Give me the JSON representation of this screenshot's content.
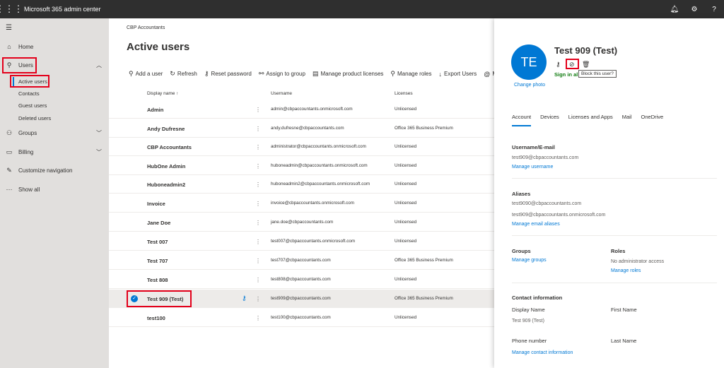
{
  "app": {
    "title": "Microsoft 365 admin center"
  },
  "topbar": {
    "icons": [
      "bell-icon",
      "gear-icon",
      "help-icon"
    ]
  },
  "sidebar": {
    "items": [
      {
        "label": "Home",
        "icon": "home-icon"
      },
      {
        "label": "Users",
        "icon": "person-icon"
      },
      {
        "label": "Groups",
        "icon": "groups-icon"
      },
      {
        "label": "Billing",
        "icon": "billing-icon"
      },
      {
        "label": "Customize navigation",
        "icon": "pencil-icon"
      },
      {
        "label": "Show all",
        "icon": "more-icon"
      }
    ],
    "users_sub": [
      "Active users",
      "Contacts",
      "Guest users",
      "Deleted users"
    ]
  },
  "main": {
    "breadcrumb": "CBP Accountants",
    "title": "Active users",
    "commands": [
      "Add a user",
      "Refresh",
      "Reset password",
      "Assign to group",
      "Manage product licenses",
      "Manage roles",
      "Export Users"
    ],
    "columns": {
      "display_name": "Display name ↑",
      "username": "Username",
      "licenses": "Licenses"
    },
    "rows": [
      {
        "name": "Admin",
        "user": "admin@cbpaccountants.onmicrosoft.com",
        "lic": "Unlicensed"
      },
      {
        "name": "Andy Dufresne",
        "user": "andy.dufresne@cbpaccountants.com",
        "lic": "Office 365 Business Premium"
      },
      {
        "name": "CBP Accountants",
        "user": "administrator@cbpaccountants.onmicrosoft.com",
        "lic": "Unlicensed"
      },
      {
        "name": "HubOne Admin",
        "user": "huboneadmin@cbpaccountants.onmicrosoft.com",
        "lic": "Unlicensed"
      },
      {
        "name": "Huboneadmin2",
        "user": "huboneadmin2@cbpaccountants.onmicrosoft.com",
        "lic": "Unlicensed"
      },
      {
        "name": "Invoice",
        "user": "invoice@cbpaccountants.onmicrosoft.com",
        "lic": "Unlicensed"
      },
      {
        "name": "Jane Doe",
        "user": "jane.doe@cbpaccountants.com",
        "lic": "Unlicensed"
      },
      {
        "name": "Test 007",
        "user": "test007@cbpaccountants.onmicrosoft.com",
        "lic": "Unlicensed"
      },
      {
        "name": "Test 707",
        "user": "test707@cbpaccountants.com",
        "lic": "Office 365 Business Premium"
      },
      {
        "name": "Test 808",
        "user": "test808@cbpaccountants.com",
        "lic": "Unlicensed"
      },
      {
        "name": "Test 909 (Test)",
        "user": "test909@cbpaccountants.com",
        "lic": "Office 365 Business Premium"
      },
      {
        "name": "test100",
        "user": "test100@cbpaccountants.com",
        "lic": "Unlicensed"
      }
    ]
  },
  "panel": {
    "initials": "TE",
    "name": "Test 909 (Test)",
    "signin": "Sign in al",
    "tooltip": "Block this user?",
    "change_photo": "Change photo",
    "tabs": [
      "Account",
      "Devices",
      "Licenses and Apps",
      "Mail",
      "OneDrive"
    ],
    "username_heading": "Username/E-mail",
    "username_value": "test909@cbpaccountants.com",
    "manage_username": "Manage username",
    "aliases_heading": "Aliases",
    "alias1": "test9090@cbpaccountants.com",
    "alias2": "test909@cbpaccountants.onmicrosoft.com",
    "manage_aliases": "Manage email aliases",
    "groups_heading": "Groups",
    "manage_groups": "Manage groups",
    "roles_heading": "Roles",
    "roles_value": "No administrator access",
    "manage_roles": "Manage roles",
    "contact_heading": "Contact information",
    "display_name_label": "Display Name",
    "display_name_value": "Test 909 (Test)",
    "first_name_label": "First Name",
    "phone_label": "Phone number",
    "last_name_label": "Last Name",
    "manage_contact": "Manage contact information"
  },
  "colors": {
    "accent": "#0078d4",
    "highlight": "#e3001b",
    "topbar": "#2f2f2f"
  }
}
